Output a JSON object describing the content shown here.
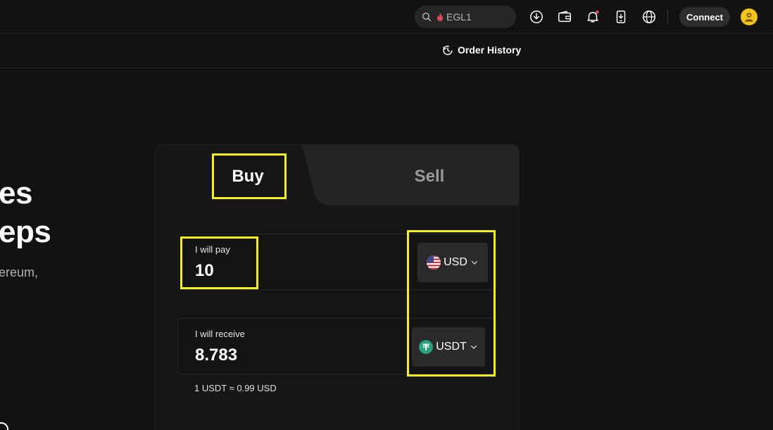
{
  "header": {
    "search_text": "EGL1",
    "connect_label": "Connect"
  },
  "subnav": {
    "order_history_label": "Order History"
  },
  "hero": {
    "line1": "es",
    "line2": "eps",
    "subtitle": "ereum,"
  },
  "card": {
    "tabs": {
      "buy_label": "Buy",
      "sell_label": "Sell"
    },
    "pay": {
      "label": "I will pay",
      "value": "10",
      "currency": "USD"
    },
    "receive": {
      "label": "I will receive",
      "value": "8.783",
      "currency": "USDT"
    },
    "rate_text": "1 USDT ≈ 0.99 USD"
  },
  "icons": [
    "search-icon",
    "fire-icon",
    "download-icon",
    "wallet-icon",
    "bell-icon",
    "mobile-download-icon",
    "globe-icon",
    "avatar-icon",
    "clock-history-icon",
    "us-flag-icon",
    "tether-icon",
    "chevron-down-icon"
  ],
  "colors": {
    "background": "#121212",
    "highlight": "#f5f218",
    "tether_green": "#26a17b",
    "notification_dot": "#e0465a",
    "avatar_yellow": "#f0c419"
  }
}
